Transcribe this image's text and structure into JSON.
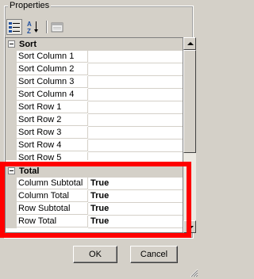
{
  "panel": {
    "title": "Properties"
  },
  "toolbar": {
    "categorized": "categorized-view-icon",
    "alphabetical_icon": "sort-az-icon",
    "pages": "property-pages-icon"
  },
  "sort_category": {
    "label": "Sort",
    "rows": [
      {
        "name": "Sort Column 1",
        "value": ""
      },
      {
        "name": "Sort Column 2",
        "value": ""
      },
      {
        "name": "Sort Column 3",
        "value": ""
      },
      {
        "name": "Sort Column 4",
        "value": ""
      },
      {
        "name": "Sort Row 1",
        "value": ""
      },
      {
        "name": "Sort Row 2",
        "value": ""
      },
      {
        "name": "Sort Row 3",
        "value": ""
      },
      {
        "name": "Sort Row 4",
        "value": ""
      },
      {
        "name": "Sort Row 5",
        "value": ""
      }
    ]
  },
  "total_category": {
    "label": "Total",
    "rows": [
      {
        "name": "Column Subtotal",
        "value": "True"
      },
      {
        "name": "Column Total",
        "value": "True"
      },
      {
        "name": "Row Subtotal",
        "value": "True"
      },
      {
        "name": "Row Total",
        "value": "True"
      }
    ]
  },
  "buttons": {
    "ok": "OK",
    "cancel": "Cancel"
  },
  "colors": {
    "highlight": "#ff0000",
    "face": "#d4d0c8"
  }
}
